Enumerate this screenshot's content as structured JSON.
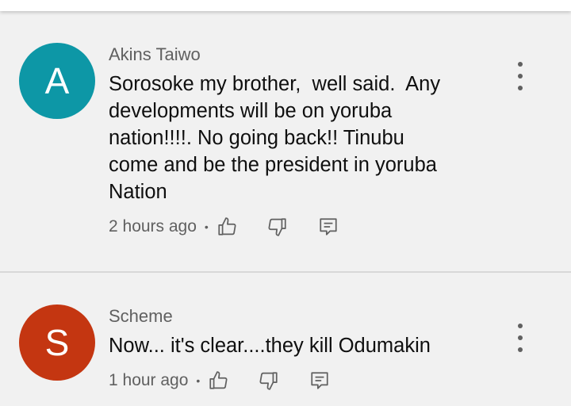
{
  "comments": [
    {
      "avatar_letter": "A",
      "avatar_color": "#0d97a6",
      "author": "Akins Taiwo",
      "lines": [
        "Sorosoke my brother,  well said.  Any",
        "developments will be on yoruba",
        "nation!!!!. No going back!! Tinubu",
        "come and be the president in yoruba",
        "Nation"
      ],
      "time": "2 hours ago",
      "separator": "•"
    },
    {
      "avatar_letter": "S",
      "avatar_color": "#c43611",
      "author": "Scheme",
      "lines": [
        "Now... it's clear....they kill Odumakin"
      ],
      "time": "1 hour ago",
      "separator": "•"
    }
  ],
  "icons": [
    "like-icon",
    "dislike-icon",
    "reply-icon",
    "more-options-icon"
  ]
}
